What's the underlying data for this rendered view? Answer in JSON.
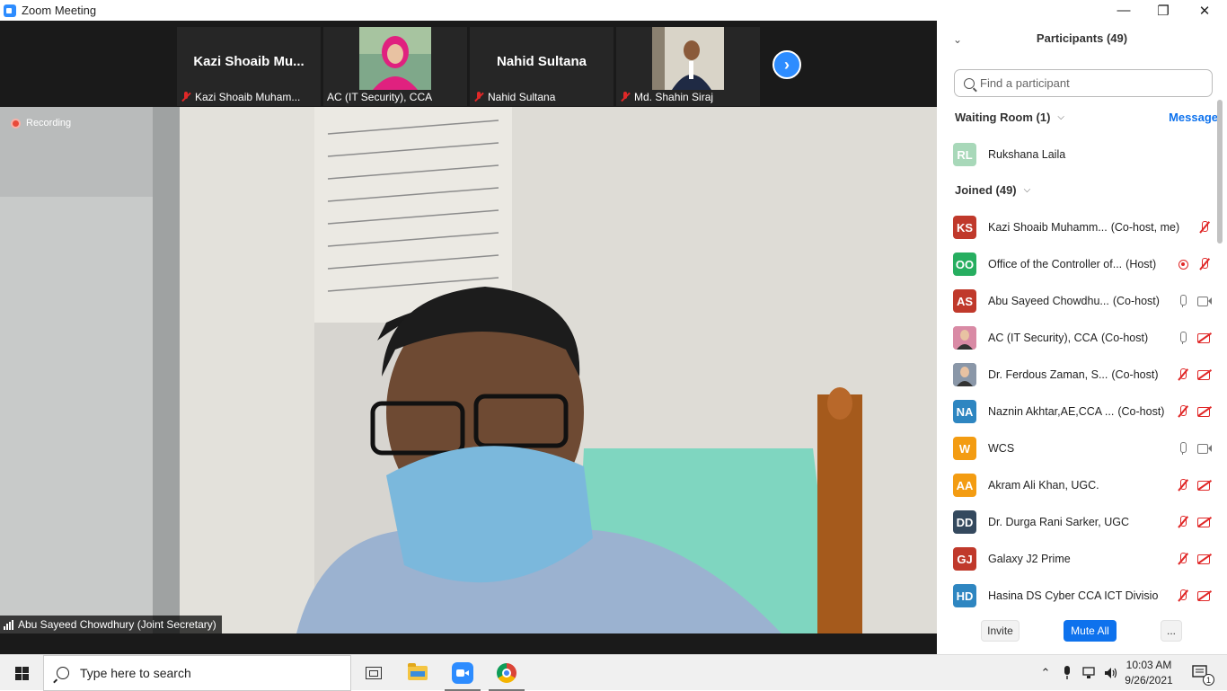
{
  "window": {
    "title": "Zoom Meeting",
    "minimize": "—",
    "maximize": "❐",
    "close": "✕"
  },
  "thumbnails": [
    {
      "big_name": "Kazi  Shoaib  Mu...",
      "label": "Kazi Shoaib Muham...",
      "muted": true,
      "has_photo": false
    },
    {
      "big_name": "",
      "label": "AC (IT Security), CCA",
      "muted": false,
      "has_photo": true
    },
    {
      "big_name": "Nahid Sultana",
      "label": "Nahid Sultana",
      "muted": true,
      "has_photo": false
    },
    {
      "big_name": "",
      "label": "Md. Shahin Siraj",
      "muted": true,
      "has_photo": true
    }
  ],
  "next_arrow": "›",
  "recording_label": "Recording",
  "active_speaker": "Abu Sayeed Chowdhury (Joint Secretary)",
  "panel": {
    "title": "Participants (49)",
    "collapse_icon": "⌄",
    "search_placeholder": "Find a participant",
    "waiting_room": "Waiting Room (1)",
    "message_link": "Message",
    "joined": "Joined (49)",
    "waiting": [
      {
        "initials": "RL",
        "name": "Rukshana Laila",
        "color": "#a8d8b9"
      }
    ],
    "participants": [
      {
        "initials": "KS",
        "name": "Kazi Shoaib Muhamm...",
        "role": "(Co-host, me)",
        "color": "#c0392b",
        "icons": [
          "mic-off"
        ]
      },
      {
        "initials": "OO",
        "name": "Office of the Controller of...",
        "role": "(Host)",
        "color": "#27ae60",
        "icons": [
          "rec",
          "mic-off"
        ]
      },
      {
        "initials": "AS",
        "name": "Abu Sayeed Chowdhu...",
        "role": "(Co-host)",
        "color": "#c0392b",
        "icons": [
          "mic",
          "vid"
        ]
      },
      {
        "initials": "",
        "name": "AC (IT Security), CCA",
        "role": "(Co-host)",
        "color": "#d98aa5",
        "icons": [
          "mic",
          "vid-off"
        ]
      },
      {
        "initials": "",
        "name": "Dr. Ferdous Zaman, S...",
        "role": "(Co-host)",
        "color": "#8a97a8",
        "icons": [
          "mic-off",
          "vid-off"
        ]
      },
      {
        "initials": "NA",
        "name": "Naznin Akhtar,AE,CCA ...",
        "role": "(Co-host)",
        "color": "#2e86c1",
        "icons": [
          "mic-off",
          "vid-off"
        ]
      },
      {
        "initials": "W",
        "name": "WCS",
        "role": "",
        "color": "#f39c12",
        "icons": [
          "mic",
          "vid"
        ]
      },
      {
        "initials": "AA",
        "name": "Akram Ali Khan, UGC.",
        "role": "",
        "color": "#f39c12",
        "icons": [
          "mic-off",
          "vid-off"
        ]
      },
      {
        "initials": "DD",
        "name": "Dr. Durga Rani Sarker, UGC",
        "role": "",
        "color": "#34495e",
        "icons": [
          "mic-off",
          "vid-off"
        ]
      },
      {
        "initials": "GJ",
        "name": "Galaxy J2 Prime",
        "role": "",
        "color": "#c0392b",
        "icons": [
          "mic-off",
          "vid-off"
        ]
      },
      {
        "initials": "HD",
        "name": "Hasina DS Cyber CCA ICT Divisio...",
        "role": "",
        "color": "#2e86c1",
        "icons": [
          "mic-off",
          "vid-off"
        ]
      }
    ],
    "footer": {
      "invite": "Invite",
      "mute_all": "Mute All",
      "more": "..."
    }
  },
  "taskbar": {
    "search_placeholder": "Type here to search",
    "tray_chevron": "⌃",
    "time": "10:03 AM",
    "date": "9/26/2021",
    "notification_count": "1"
  }
}
